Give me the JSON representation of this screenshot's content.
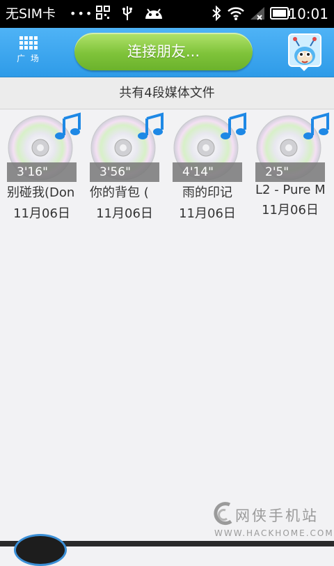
{
  "status_bar": {
    "carrier": "无SIM卡",
    "dots": "•••",
    "time": "10:01"
  },
  "header": {
    "plaza_label": "广 场",
    "connect_label": "连接朋友..."
  },
  "subheader": {
    "summary": "共有4段媒体文件"
  },
  "media": [
    {
      "duration": "3'16\"",
      "title": "别碰我(Don",
      "date": "11月06日"
    },
    {
      "duration": "3'56\"",
      "title": "你的背包 (",
      "date": "11月06日"
    },
    {
      "duration": "4'14\"",
      "title": "雨的印记",
      "date": "11月06日"
    },
    {
      "duration": "2'5\"",
      "title": "L2 - Pure M",
      "date": "11月06日"
    }
  ],
  "watermark": {
    "name": "网侠手机站",
    "url": "WWW.HACKHOME.COM"
  },
  "colors": {
    "header_blue": "#3aa6ef",
    "connect_green": "#7fc33a"
  }
}
